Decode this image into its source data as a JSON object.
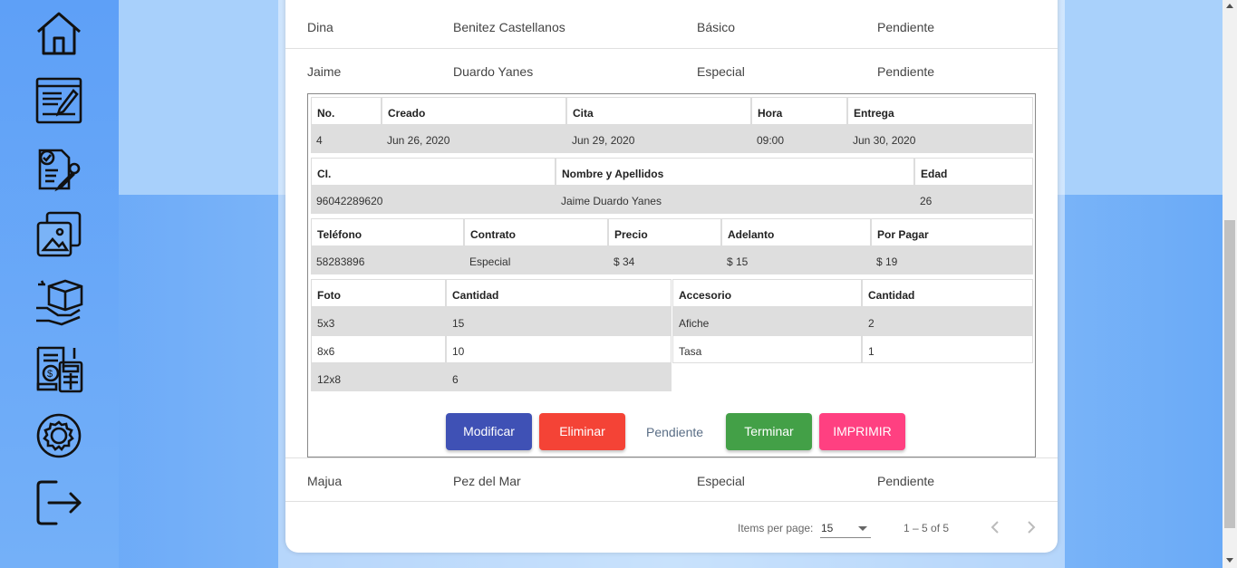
{
  "sidebar": {
    "items": [
      {
        "icon": "home-icon"
      },
      {
        "icon": "edit-form-icon"
      },
      {
        "icon": "checklist-icon"
      },
      {
        "icon": "gallery-icon"
      },
      {
        "icon": "delivery-box-icon"
      },
      {
        "icon": "invoice-calculator-icon"
      },
      {
        "icon": "settings-gear-icon"
      },
      {
        "icon": "logout-icon"
      }
    ]
  },
  "rows": [
    {
      "nombre": "Dina",
      "apellidos": "Benitez Castellanos",
      "contrato": "Básico",
      "estado": "Pendiente"
    },
    {
      "nombre": "Jaime",
      "apellidos": "Duardo Yanes",
      "contrato": "Especial",
      "estado": "Pendiente"
    },
    {
      "nombre": "Majua",
      "apellidos": "Pez del Mar",
      "contrato": "Especial",
      "estado": "Pendiente"
    }
  ],
  "detail": {
    "t1": {
      "headers": [
        "No.",
        "Creado",
        "Cita",
        "Hora",
        "Entrega"
      ],
      "values": [
        "4",
        "Jun 26, 2020",
        "Jun 29, 2020",
        "09:00",
        "Jun 30, 2020"
      ]
    },
    "t2": {
      "headers": [
        "CI.",
        "Nombre y Apellidos",
        "Edad"
      ],
      "values": [
        "96042289620",
        "Jaime Duardo Yanes",
        "26"
      ]
    },
    "t3": {
      "headers": [
        "Teléfono",
        "Contrato",
        "Precio",
        "Adelanto",
        "Por Pagar"
      ],
      "values": [
        "58283896",
        "Especial",
        "$ 34",
        "$ 15",
        "$ 19"
      ]
    },
    "fotos": {
      "headers": [
        "Foto",
        "Cantidad"
      ],
      "rows": [
        [
          "5x3",
          "15"
        ],
        [
          "8x6",
          "10"
        ],
        [
          "12x8",
          "6"
        ]
      ]
    },
    "accesorios": {
      "headers": [
        "Accesorio",
        "Cantidad"
      ],
      "rows": [
        [
          "Afiche",
          "2"
        ],
        [
          "Tasa",
          "1"
        ]
      ]
    },
    "actions": {
      "modificar": "Modificar",
      "eliminar": "Eliminar",
      "estado": "Pendiente",
      "terminar": "Terminar",
      "imprimir": "IMPRIMIR"
    },
    "colors": {
      "modificar": "#3f51b5",
      "eliminar": "#f44336",
      "terminar": "#43a047",
      "imprimir": "#ff4081"
    }
  },
  "paginator": {
    "items_per_page_label": "Items per page:",
    "items_per_page_value": "15",
    "range": "1 – 5 of 5"
  }
}
